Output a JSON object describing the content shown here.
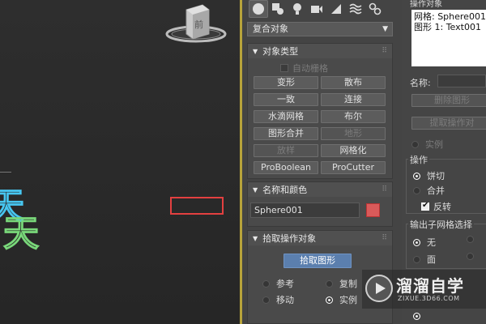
{
  "viewport": {
    "text_line_1": "天",
    "text_line_2": "天",
    "viewcube_label": "前"
  },
  "panel": {
    "tabs": [
      "create-icon",
      "modify-icon",
      "light-icon",
      "camera-icon",
      "helper-icon",
      "spacewarp-icon",
      "systems-icon"
    ],
    "category_dropdown": "复合对象",
    "object_type": {
      "title": "对象类型",
      "auto_grid": "自动栅格",
      "buttons": [
        "变形",
        "散布",
        "一致",
        "连接",
        "水滴网格",
        "布尔",
        "图形合并",
        "地形",
        "放样",
        "网格化",
        "ProBoolean",
        "ProCutter"
      ]
    },
    "name_color": {
      "title": "名称和颜色",
      "name": "Sphere001",
      "color": "#d95a5a"
    },
    "pick_operand": {
      "title": "拾取操作对象",
      "pick_button": "拾取图形",
      "radios": [
        "参考",
        "复制",
        "移动",
        "实例"
      ]
    }
  },
  "right": {
    "operands_title": "操作对象",
    "operands": [
      "网格: Sphere001",
      "图形 1: Text001"
    ],
    "name_label": "名称:",
    "delete_shape": "删除图形",
    "extract_operand": "提取操作对",
    "instance": "实例",
    "operation_title": "操作",
    "operation_options": [
      "饼切",
      "合并",
      "反转"
    ],
    "output_title": "输出子网格选择",
    "output_options": [
      "无",
      "面"
    ]
  },
  "watermark": {
    "title": "溜溜自学",
    "url": "ZIXUE.3D66.COM"
  }
}
